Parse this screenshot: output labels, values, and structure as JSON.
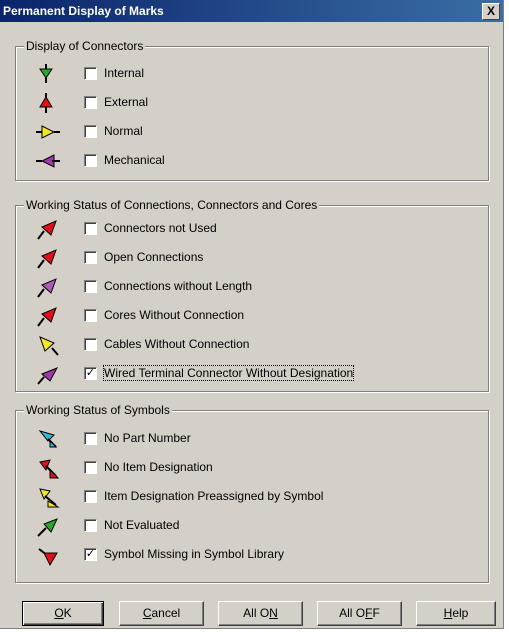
{
  "window": {
    "title": "Permanent Display of Marks",
    "close_label": "X"
  },
  "groups": [
    {
      "legend": "Display of Connectors",
      "items": [
        {
          "label": "Internal",
          "checked": false,
          "icon": "connector-internal-icon",
          "color": "#2aa52a"
        },
        {
          "label": "External",
          "checked": false,
          "icon": "connector-external-icon",
          "color": "#e0101a"
        },
        {
          "label": "Normal",
          "checked": false,
          "icon": "connector-normal-icon",
          "color": "#f2e62a"
        },
        {
          "label": "Mechanical",
          "checked": false,
          "icon": "connector-mechanical-icon",
          "color": "#9e3aa8"
        }
      ]
    },
    {
      "legend": "Working Status of Connections, Connectors and Cores",
      "items": [
        {
          "label": "Connectors not Used",
          "checked": false,
          "icon": "pin-red-icon",
          "color": "#e0101a"
        },
        {
          "label": "Open Connections",
          "checked": false,
          "icon": "pin-red-icon",
          "color": "#e0101a"
        },
        {
          "label": "Connections without Length",
          "checked": false,
          "icon": "pin-purple-icon",
          "color": "#b05ab8"
        },
        {
          "label": "Cores Without Connection",
          "checked": false,
          "icon": "pin-red-icon",
          "color": "#e0101a"
        },
        {
          "label": "Cables Without Connection",
          "checked": false,
          "icon": "pin-yellow-icon",
          "color": "#f2e62a"
        },
        {
          "label": "Wired Terminal Connector Without Designation",
          "checked": true,
          "icon": "pin-purple-icon",
          "color": "#9e3aa8"
        }
      ]
    },
    {
      "legend": "Working Status of Symbols",
      "items": [
        {
          "label": "No Part Number",
          "checked": false,
          "icon": "arrow-cyan-icon",
          "color": "#37b6d6"
        },
        {
          "label": "No Item Designation",
          "checked": false,
          "icon": "arrow-red-icon",
          "color": "#e0101a"
        },
        {
          "label": "Item Designation Preassigned by Symbol",
          "checked": false,
          "icon": "arrow-yellow-icon",
          "color": "#f2e62a"
        },
        {
          "label": "Not Evaluated",
          "checked": false,
          "icon": "arrow-green-icon",
          "color": "#2aa52a"
        },
        {
          "label": "Symbol Missing in Symbol Library",
          "checked": true,
          "icon": "arrow-red-icon",
          "color": "#e0101a"
        }
      ]
    }
  ],
  "buttons": {
    "ok": {
      "pre": "",
      "key": "O",
      "post": "K"
    },
    "cancel": {
      "pre": "",
      "key": "C",
      "post": "ancel"
    },
    "all_on": {
      "pre": "All O",
      "key": "N",
      "post": ""
    },
    "all_off": {
      "pre": "All O",
      "key": "F",
      "post": "F"
    },
    "help": {
      "pre": "",
      "key": "H",
      "post": "elp"
    }
  }
}
